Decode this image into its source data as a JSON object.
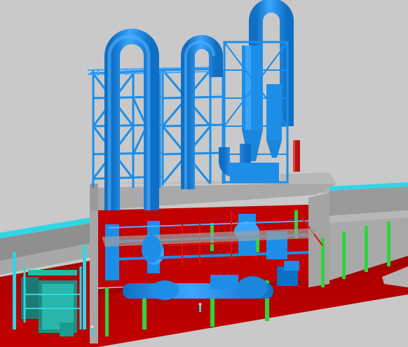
{
  "scene": {
    "colors": {
      "background": "#c9c9c9",
      "steel_blue": "#1c8ee8",
      "steel_blue_dark": "#0f6fc4",
      "steel_blue_light": "#4fb3ff",
      "floor_grey": "#9d9d9d",
      "floor_grey_light": "#b5b5b5",
      "floor_grey_dark": "#808080",
      "wall_red": "#b30000",
      "column_green": "#2fd43a",
      "equipment_teal": "#23b8a8",
      "cyan_edge": "#2fd6e6",
      "stack_red": "#b51313",
      "pipe_red": "#e01010"
    },
    "objects": [
      "loop-pipe-left",
      "loop-pipe-middle",
      "loop-pipe-right",
      "cyclone-tower",
      "steel-frame-left",
      "steel-frame-middle",
      "upper-floor-slab",
      "lower-floor-slab",
      "ground-red-floor",
      "green-columns",
      "horizontal-dryer-drum",
      "teal-equipment-left",
      "red-stack",
      "side-platforms"
    ]
  }
}
